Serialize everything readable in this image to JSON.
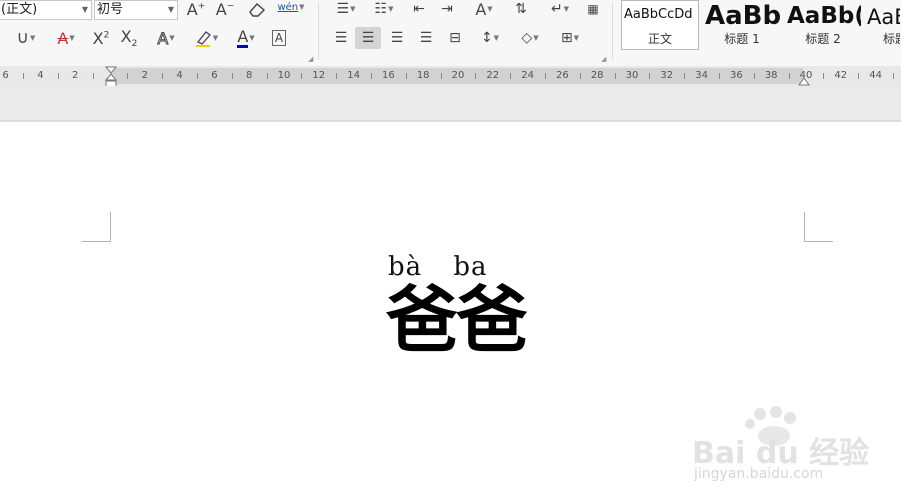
{
  "font": {
    "name": "(正文)",
    "size": "初号"
  },
  "styles": [
    {
      "sample": "AaBbCcDd",
      "name": "正文",
      "selected": true
    },
    {
      "sample": "AaBb",
      "name": "标题 1"
    },
    {
      "sample": "AaBb(",
      "name": "标题 2"
    },
    {
      "sample": "AaB",
      "name": "标题"
    }
  ],
  "toolbar": {
    "phonetic_guide_label": "wén",
    "superscript_2": "2",
    "subscript_2": "2"
  },
  "ruler": {
    "left_labels": [
      "6",
      "4",
      "2"
    ],
    "labels": [
      "2",
      "4",
      "6",
      "8",
      "10",
      "12",
      "14",
      "16",
      "18",
      "20",
      "22",
      "24",
      "26",
      "28",
      "30",
      "32",
      "34",
      "36",
      "38",
      "40",
      "42",
      "44"
    ]
  },
  "document": {
    "pinyin": "bà ba",
    "hanzi": "爸爸"
  },
  "watermark": {
    "brand": "Bai du 经验",
    "url": "jingyan.baidu.com"
  },
  "colors": {
    "font_color_underline": "#0000cc",
    "highlight_underline": "#e6d200"
  }
}
